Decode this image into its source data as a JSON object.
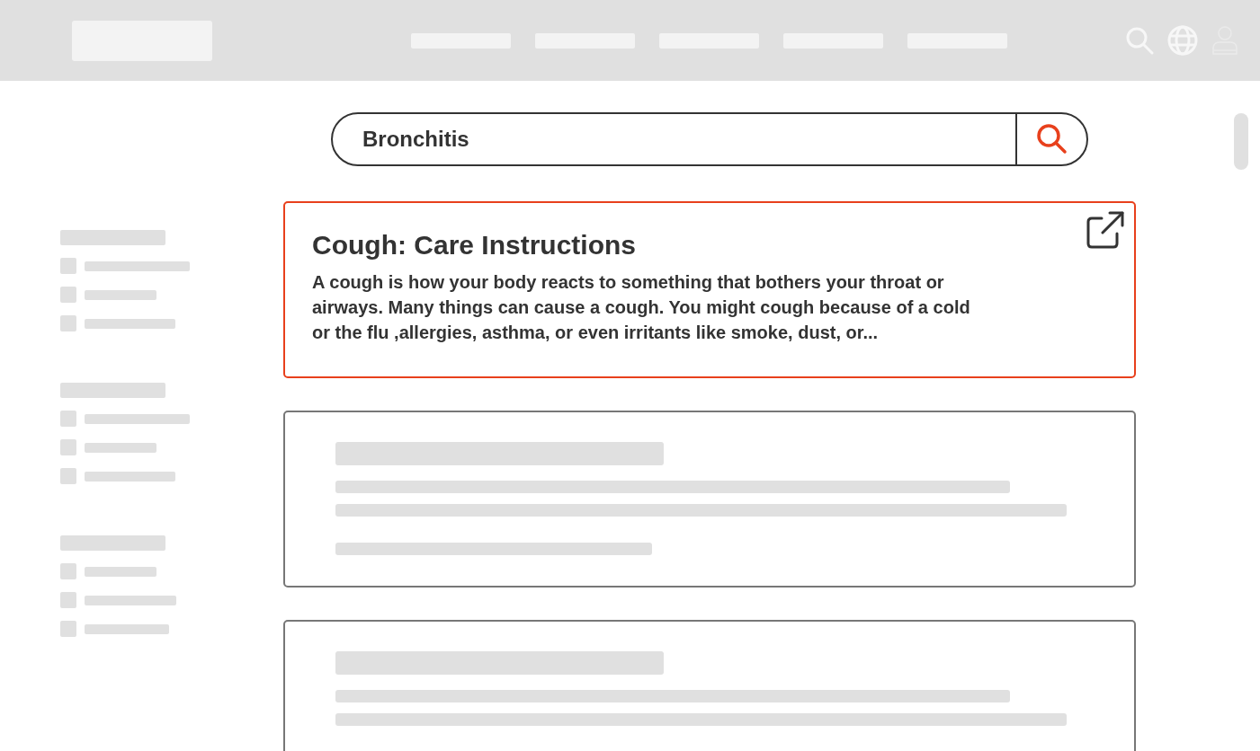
{
  "search": {
    "value": "Bronchitis"
  },
  "results": [
    {
      "kind": "article",
      "selected": true,
      "title": "Cough: Care Instructions",
      "snippet": "A cough is how your body reacts to something that bothers your throat or airways. Many things can cause a cough. You might cough because of a cold or the flu ,allergies, asthma, or even irritants like smoke, dust, or..."
    },
    {
      "kind": "skeleton",
      "selected": false
    },
    {
      "kind": "skeleton",
      "selected": false
    }
  ]
}
